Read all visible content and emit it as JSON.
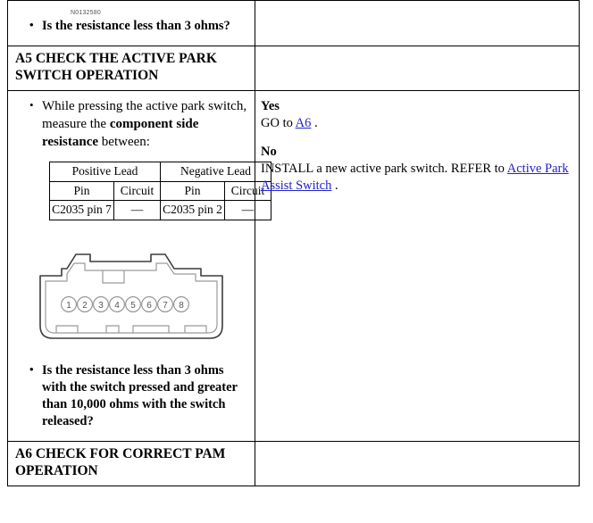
{
  "document": {
    "reference_number": "N0132580"
  },
  "rows": {
    "previous_question": {
      "bullet": "Is the resistance less than 3 ohms?"
    },
    "a5": {
      "header": "A5 CHECK THE ACTIVE PARK SWITCH OPERATION",
      "instruction_pre": "While pressing the active park switch, measure the ",
      "instruction_bold": "component side resistance",
      "instruction_post": " between:",
      "lead_table": {
        "group_headers": [
          "Positive Lead",
          "Negative Lead"
        ],
        "column_headers": [
          "Pin",
          "Circuit",
          "Pin",
          "Circuit"
        ],
        "rows": [
          [
            "C2035 pin 7",
            "—",
            "C2035 pin 2",
            "—"
          ]
        ]
      },
      "connector": {
        "pins": [
          "1",
          "2",
          "3",
          "4",
          "5",
          "6",
          "7",
          "8"
        ]
      },
      "question": "Is the resistance less than 3 ohms with the switch pressed and greater than 10,000 ohms with the switch released?",
      "answers": {
        "yes_label": "Yes",
        "yes_text_pre": "GO to ",
        "yes_link": "A6",
        "yes_text_post": " .",
        "no_label": "No",
        "no_text_pre": "INSTALL a new active park switch. REFER to ",
        "no_link": "Active Park Assist Switch",
        "no_text_post": " ."
      }
    },
    "a6": {
      "header": "A6 CHECK FOR CORRECT PAM OPERATION"
    }
  },
  "colors": {
    "link": "#2222cc",
    "border": "#000000",
    "text": "#000000",
    "connector_line": "#9a9a9a",
    "connector_outline": "#3c3c3c"
  }
}
